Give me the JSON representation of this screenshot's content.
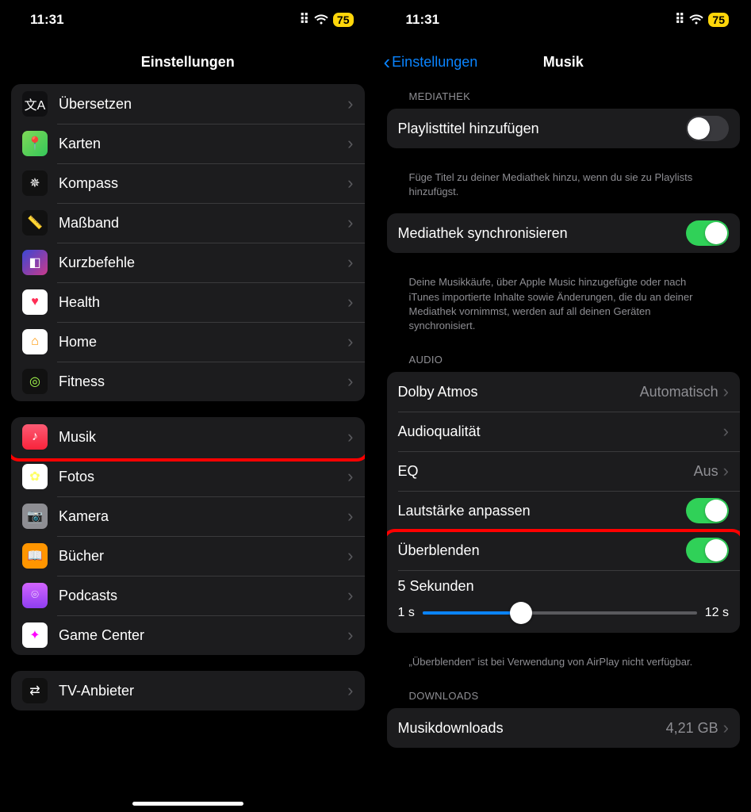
{
  "status": {
    "time": "11:31",
    "battery": "75"
  },
  "left": {
    "title": "Einstellungen",
    "group1": [
      {
        "label": "Übersetzen",
        "icon": "translate"
      },
      {
        "label": "Karten",
        "icon": "maps"
      },
      {
        "label": "Kompass",
        "icon": "compass"
      },
      {
        "label": "Maßband",
        "icon": "measure"
      },
      {
        "label": "Kurzbefehle",
        "icon": "shortcuts"
      },
      {
        "label": "Health",
        "icon": "health"
      },
      {
        "label": "Home",
        "icon": "home"
      },
      {
        "label": "Fitness",
        "icon": "fitness"
      }
    ],
    "group2": [
      {
        "label": "Musik",
        "icon": "music",
        "highlight": true
      },
      {
        "label": "Fotos",
        "icon": "photos"
      },
      {
        "label": "Kamera",
        "icon": "camera"
      },
      {
        "label": "Bücher",
        "icon": "books"
      },
      {
        "label": "Podcasts",
        "icon": "podcasts"
      },
      {
        "label": "Game Center",
        "icon": "gamecenter"
      }
    ],
    "group3": [
      {
        "label": "TV-Anbieter",
        "icon": "tv"
      }
    ]
  },
  "right": {
    "back": "Einstellungen",
    "title": "Musik",
    "mediathek": {
      "header": "Mediathek",
      "playlist_label": "Playlisttitel hinzufügen",
      "playlist_on": false,
      "playlist_footer": "Füge Titel zu deiner Mediathek hinzu, wenn du sie zu Playlists hinzufügst.",
      "sync_label": "Mediathek synchronisieren",
      "sync_on": true,
      "sync_footer": "Deine Musikkäufe, über Apple Music hinzugefügte oder nach iTunes importierte Inhalte sowie Änderungen, die du an deiner Mediathek vornimmst, werden auf all deinen Geräten synchronisiert."
    },
    "audio": {
      "header": "Audio",
      "dolby_label": "Dolby Atmos",
      "dolby_value": "Automatisch",
      "quality_label": "Audioqualität",
      "eq_label": "EQ",
      "eq_value": "Aus",
      "volume_label": "Lautstärke anpassen",
      "volume_on": true,
      "crossfade_label": "Überblenden",
      "crossfade_on": true,
      "crossfade_value": "5 Sekunden",
      "crossfade_min": "1 s",
      "crossfade_max": "12 s",
      "crossfade_percent": 36,
      "crossfade_footer": "„Überblenden“ ist bei Verwendung von AirPlay nicht verfügbar."
    },
    "downloads": {
      "header": "Downloads",
      "label": "Musikdownloads",
      "value": "4,21 GB"
    }
  }
}
